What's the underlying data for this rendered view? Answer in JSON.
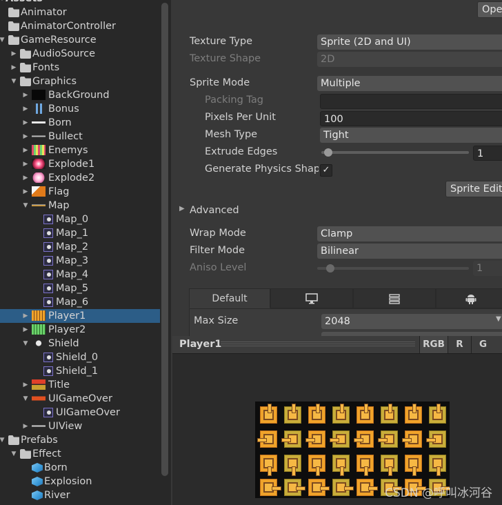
{
  "project": {
    "rows": [
      {
        "label": "Assets",
        "indent": 0,
        "arrow": "down",
        "icon": "none",
        "bold": true
      },
      {
        "label": "Animator",
        "indent": 0,
        "arrow": "none",
        "icon": "folder"
      },
      {
        "label": "AnimatorController",
        "indent": 0,
        "arrow": "none",
        "icon": "folder"
      },
      {
        "label": "GameResource",
        "indent": 0,
        "arrow": "down",
        "icon": "folder"
      },
      {
        "label": "AudioSource",
        "indent": 1,
        "arrow": "right",
        "icon": "folder"
      },
      {
        "label": "Fonts",
        "indent": 1,
        "arrow": "right",
        "icon": "folder"
      },
      {
        "label": "Graphics",
        "indent": 1,
        "arrow": "down",
        "icon": "folder"
      },
      {
        "label": "BackGround",
        "indent": 2,
        "arrow": "right",
        "icon": "thumb-black"
      },
      {
        "label": "Bonus",
        "indent": 2,
        "arrow": "right",
        "icon": "thumb-bonus"
      },
      {
        "label": "Born",
        "indent": 2,
        "arrow": "right",
        "icon": "thumb-born"
      },
      {
        "label": "Bullect",
        "indent": 2,
        "arrow": "right",
        "icon": "thumb-bullet"
      },
      {
        "label": "Enemys",
        "indent": 2,
        "arrow": "right",
        "icon": "thumb-enemys"
      },
      {
        "label": "Explode1",
        "indent": 2,
        "arrow": "right",
        "icon": "thumb-explode1"
      },
      {
        "label": "Explode2",
        "indent": 2,
        "arrow": "right",
        "icon": "thumb-explode2"
      },
      {
        "label": "Flag",
        "indent": 2,
        "arrow": "right",
        "icon": "thumb-flag"
      },
      {
        "label": "Map",
        "indent": 2,
        "arrow": "down",
        "icon": "thumb-map"
      },
      {
        "label": "Map_0",
        "indent": 3,
        "arrow": "none",
        "icon": "sprite"
      },
      {
        "label": "Map_1",
        "indent": 3,
        "arrow": "none",
        "icon": "sprite"
      },
      {
        "label": "Map_2",
        "indent": 3,
        "arrow": "none",
        "icon": "sprite"
      },
      {
        "label": "Map_3",
        "indent": 3,
        "arrow": "none",
        "icon": "sprite"
      },
      {
        "label": "Map_4",
        "indent": 3,
        "arrow": "none",
        "icon": "sprite"
      },
      {
        "label": "Map_5",
        "indent": 3,
        "arrow": "none",
        "icon": "sprite"
      },
      {
        "label": "Map_6",
        "indent": 3,
        "arrow": "none",
        "icon": "sprite"
      },
      {
        "label": "Player1",
        "indent": 2,
        "arrow": "right",
        "icon": "thumb-player1",
        "selected": true
      },
      {
        "label": "Player2",
        "indent": 2,
        "arrow": "right",
        "icon": "thumb-player2"
      },
      {
        "label": "Shield",
        "indent": 2,
        "arrow": "down",
        "icon": "thumb-shield"
      },
      {
        "label": "Shield_0",
        "indent": 3,
        "arrow": "none",
        "icon": "sprite"
      },
      {
        "label": "Shield_1",
        "indent": 3,
        "arrow": "none",
        "icon": "sprite"
      },
      {
        "label": "Title",
        "indent": 2,
        "arrow": "right",
        "icon": "thumb-title"
      },
      {
        "label": "UIGameOver",
        "indent": 2,
        "arrow": "down",
        "icon": "thumb-gameover"
      },
      {
        "label": "UIGameOver",
        "indent": 3,
        "arrow": "none",
        "icon": "sprite"
      },
      {
        "label": "UIView",
        "indent": 2,
        "arrow": "right",
        "icon": "thumb-uiview"
      },
      {
        "label": "Prefabs",
        "indent": 0,
        "arrow": "down",
        "icon": "folder"
      },
      {
        "label": "Effect",
        "indent": 1,
        "arrow": "down",
        "icon": "folder"
      },
      {
        "label": "Born",
        "indent": 2,
        "arrow": "none",
        "icon": "prefab"
      },
      {
        "label": "Explosion",
        "indent": 2,
        "arrow": "none",
        "icon": "prefab"
      },
      {
        "label": "River",
        "indent": 2,
        "arrow": "none",
        "icon": "prefab"
      }
    ]
  },
  "inspector": {
    "open_button": "Ope",
    "texture_type_label": "Texture Type",
    "texture_type_value": "Sprite (2D and UI)",
    "texture_shape_label": "Texture Shape",
    "texture_shape_value": "2D",
    "sprite_mode_label": "Sprite Mode",
    "sprite_mode_value": "Multiple",
    "packing_tag_label": "Packing Tag",
    "pixels_per_unit_label": "Pixels Per Unit",
    "pixels_per_unit_value": "100",
    "mesh_type_label": "Mesh Type",
    "mesh_type_value": "Tight",
    "extrude_edges_label": "Extrude Edges",
    "extrude_edges_value": "1",
    "generate_physics_label": "Generate Physics Shap",
    "generate_physics_checked": "✓",
    "sprite_editor_button": "Sprite Edito",
    "advanced_label": "Advanced",
    "wrap_mode_label": "Wrap Mode",
    "wrap_mode_value": "Clamp",
    "filter_mode_label": "Filter Mode",
    "filter_mode_value": "Bilinear",
    "aniso_level_label": "Aniso Level",
    "aniso_level_value": "1",
    "platform_tabs": [
      "Default",
      "monitor-icon",
      "sliders-icon",
      "android-icon"
    ],
    "max_size_label": "Max Size",
    "max_size_value": "2048"
  },
  "preview": {
    "title": "Player1",
    "channels": [
      "RGB",
      "R",
      "G"
    ]
  },
  "watermark": "CSDN @呼叫冰河谷",
  "colors": {
    "selection": "#2c5d87",
    "tank": "#f0a32a"
  }
}
